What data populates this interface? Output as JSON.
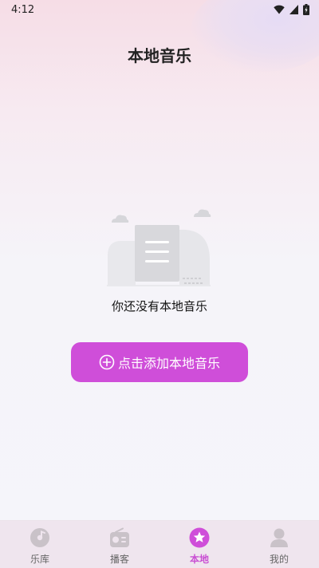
{
  "status_bar": {
    "time": "4:12"
  },
  "header": {
    "title": "本地音乐"
  },
  "empty_state": {
    "message": "你还没有本地音乐"
  },
  "actions": {
    "add_button_label": "点击添加本地音乐"
  },
  "tabs": [
    {
      "label": "乐库",
      "icon": "music-disc-icon",
      "active": false
    },
    {
      "label": "播客",
      "icon": "radio-icon",
      "active": false
    },
    {
      "label": "本地",
      "icon": "star-icon",
      "active": true
    },
    {
      "label": "我的",
      "icon": "person-icon",
      "active": false
    }
  ],
  "colors": {
    "accent": "#cf4ed9",
    "tab_active": "#c94fd3",
    "tab_inactive": "#c9c2c8"
  }
}
